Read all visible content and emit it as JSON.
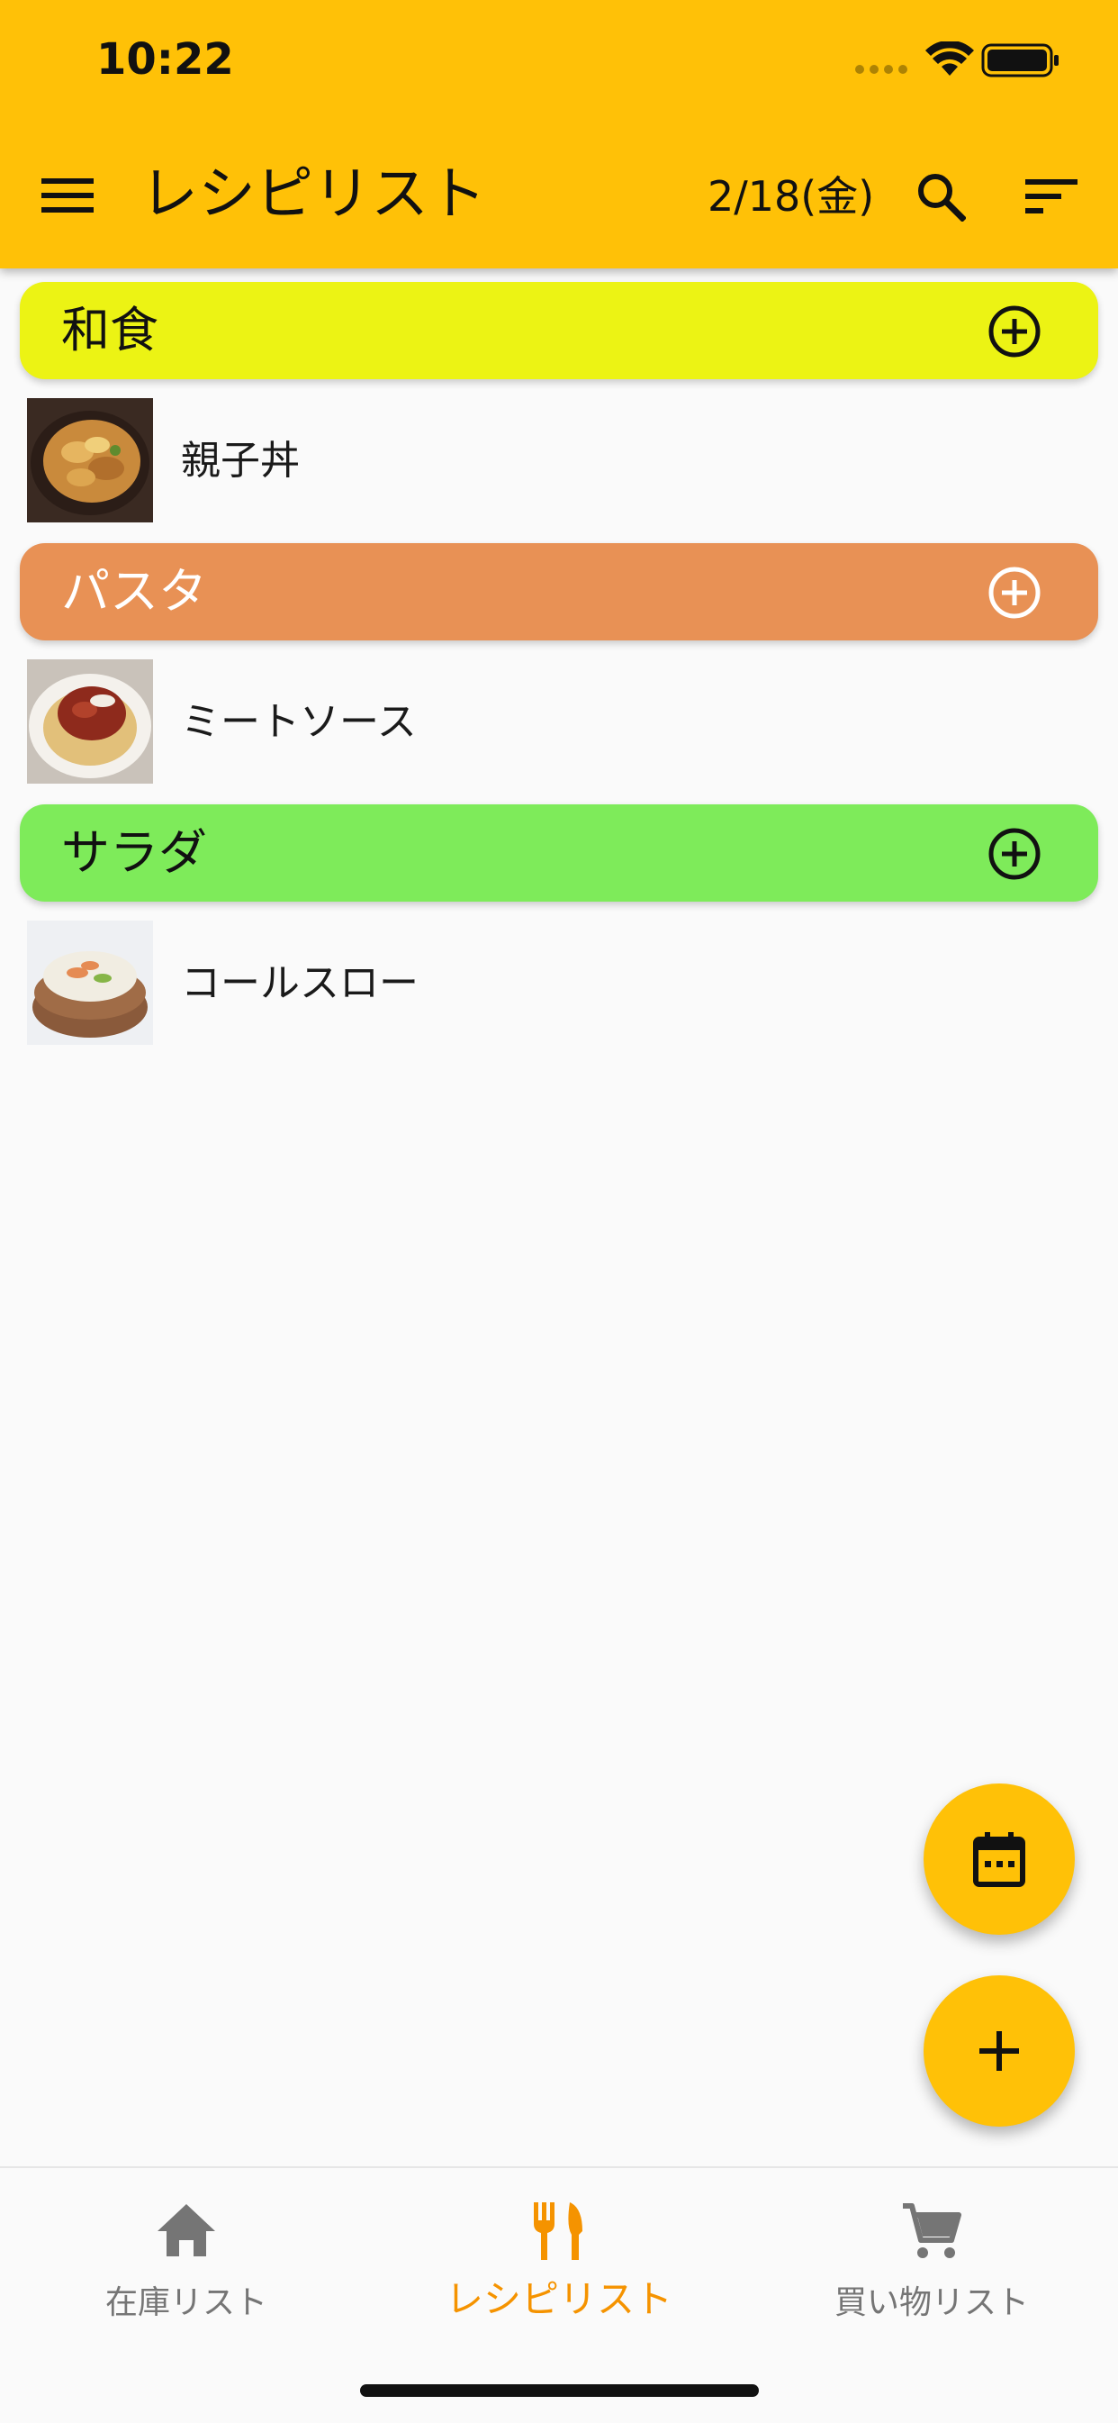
{
  "status_bar": {
    "time": "10:22"
  },
  "header": {
    "title": "レシピリスト",
    "date": "2/18(金)",
    "background": "#ffc107"
  },
  "categories": [
    {
      "label": "和食",
      "color": "#ecf314",
      "text_color": "#111111",
      "recipes": [
        {
          "name": "親子丼",
          "image": "oyakodon-photo"
        }
      ]
    },
    {
      "label": "パスタ",
      "color": "#e89155",
      "text_color": "#ffffff",
      "recipes": [
        {
          "name": "ミートソース",
          "image": "meat-sauce-pasta-photo"
        }
      ]
    },
    {
      "label": "サラダ",
      "color": "#7eeb5a",
      "text_color": "#111111",
      "recipes": [
        {
          "name": "コールスロー",
          "image": "coleslaw-photo"
        }
      ]
    }
  ],
  "fabs": {
    "calendar_icon": "calendar-icon",
    "add_icon": "plus-icon",
    "color": "#ffc107"
  },
  "bottom_nav": {
    "items": [
      {
        "label": "在庫リスト",
        "icon": "home-icon",
        "active": false
      },
      {
        "label": "レシピリスト",
        "icon": "fork-knife-icon",
        "active": true
      },
      {
        "label": "買い物リスト",
        "icon": "cart-icon",
        "active": false
      }
    ],
    "active_color": "#f59300",
    "inactive_color": "#757575"
  }
}
